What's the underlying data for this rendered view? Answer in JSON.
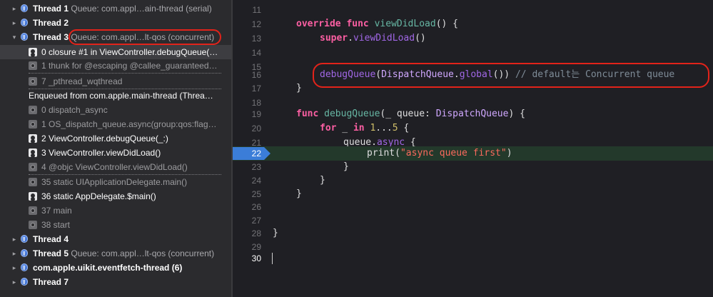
{
  "navigator": {
    "thread1": {
      "name": "Thread 1",
      "queue": "Queue: com.appl…ain-thread (serial)"
    },
    "thread2": {
      "name": "Thread 2"
    },
    "thread3": {
      "name": "Thread 3",
      "queue": "Queue: com.appl…lt-qos (concurrent)"
    },
    "frames_top": [
      {
        "text": "0 closure #1 in ViewController.debugQueue(…",
        "kind": "user"
      },
      {
        "text": "1 thunk for @escaping @callee_guaranteed…",
        "kind": "sys"
      },
      {
        "text": "7 _pthread_wqthread",
        "kind": "sys"
      }
    ],
    "enqueued_label": "Enqueued from com.apple.main-thread (Threa…",
    "frames_enqueued": [
      {
        "text": "0 dispatch_async",
        "kind": "sys"
      },
      {
        "text": "1 OS_dispatch_queue.async(group:qos:flag…",
        "kind": "sys"
      },
      {
        "text": "2 ViewController.debugQueue(_:)",
        "kind": "user"
      },
      {
        "text": "3 ViewController.viewDidLoad()",
        "kind": "user"
      },
      {
        "text": "4 @objc ViewController.viewDidLoad()",
        "kind": "sys"
      },
      {
        "text": "35 static UIApplicationDelegate.main()",
        "kind": "sys"
      },
      {
        "text": "36 static AppDelegate.$main()",
        "kind": "user"
      },
      {
        "text": "37 main",
        "kind": "sys"
      },
      {
        "text": "38 start",
        "kind": "sys"
      }
    ],
    "thread4": {
      "name": "Thread 4"
    },
    "thread5": {
      "name": "Thread 5",
      "queue": "Queue: com.appl…lt-qos (concurrent)"
    },
    "eventfetch": {
      "name": "com.apple.uikit.eventfetch-thread (6)"
    },
    "thread7": {
      "name": "Thread 7"
    }
  },
  "editor": {
    "line_numbers": [
      "11",
      "12",
      "13",
      "14",
      "15",
      "16",
      "17",
      "18",
      "19",
      "20",
      "21",
      "22",
      "23",
      "24",
      "25",
      "26",
      "27",
      "28",
      "29",
      "30"
    ],
    "current_line": "22",
    "code": {
      "l12": {
        "kw1": "override",
        "kw2": "func",
        "name": "viewDidLoad",
        "rest": "() {"
      },
      "l13": {
        "kw": "super",
        "dot": ".",
        "name": "viewDidLoad",
        "rest": "()"
      },
      "l16": {
        "call": "debugQueue",
        "p1": "(",
        "type": "DispatchQueue",
        "dot": ".",
        "member": "global",
        "p2": "()) ",
        "comment": "// default는 Concurrent queue"
      },
      "l17": {
        "text": "}"
      },
      "l19": {
        "kw": "func",
        "name": "debugQueue",
        "p1": "(_ queue: ",
        "type": "DispatchQueue",
        "p2": ") {"
      },
      "l20": {
        "kw1": "for",
        "mid": " _ ",
        "kw2": "in",
        "sp": " ",
        "n1": "1",
        "op": "...",
        "n2": "5",
        "rest": " {"
      },
      "l21": {
        "obj": "queue",
        "dot": ".",
        "member": "async",
        "rest": " {"
      },
      "l22": {
        "call": "print",
        "p1": "(",
        "str": "\"async queue first\"",
        "p2": ")"
      },
      "l23": {
        "text": "}"
      },
      "l24": {
        "text": "}"
      },
      "l25": {
        "text": "}"
      },
      "l28": {
        "text": "}"
      }
    }
  },
  "colors": {
    "annotation": "#e2231a",
    "breakpoint": "#3b7dd8",
    "keyword": "#fc5fa3",
    "string": "#fc6a5d"
  }
}
